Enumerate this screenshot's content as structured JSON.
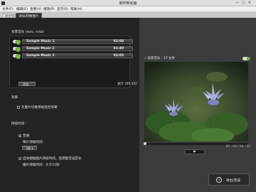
{
  "window": {
    "title": "制作新动画"
  },
  "menu": [
    "文件(F)",
    "编辑(E)",
    "查看(V)",
    "播放(P)",
    "显示(S)",
    "帮助(H)"
  ],
  "tabs": [
    "混合音效",
    "添加/转换图片"
  ],
  "left": {
    "bg_music_label": "背景音乐 (wav, m4a)",
    "tracks": [
      {
        "name": "Sample Music 1",
        "duration": "02:00"
      },
      {
        "name": "Sample Music 2",
        "duration": "01:40"
      },
      {
        "name": "Sample Music 3",
        "duration": "02:03"
      }
    ],
    "add_button": "添加...",
    "total_label": "总计 [05:43]",
    "effects_label": "效果",
    "loop_label": "为图片切换添加混合效果",
    "duration_label": "持续时间 :",
    "standard_label": "普通",
    "per_image_label": "每片持续时间 :",
    "per_image_value": "5秒",
    "auto_label": "自动根据图片持续时间，且把配音设定长",
    "image_count_label": "播片持续时间 : 大于15秒"
  },
  "right": {
    "preview_label": "背景音乐 : 3个文件",
    "time_display": "00 : 00 / 00 : 00",
    "save_label": "导出/完成"
  },
  "colors": {
    "accent_green": "#79c142",
    "dark_panel": "#1b1b1b"
  }
}
